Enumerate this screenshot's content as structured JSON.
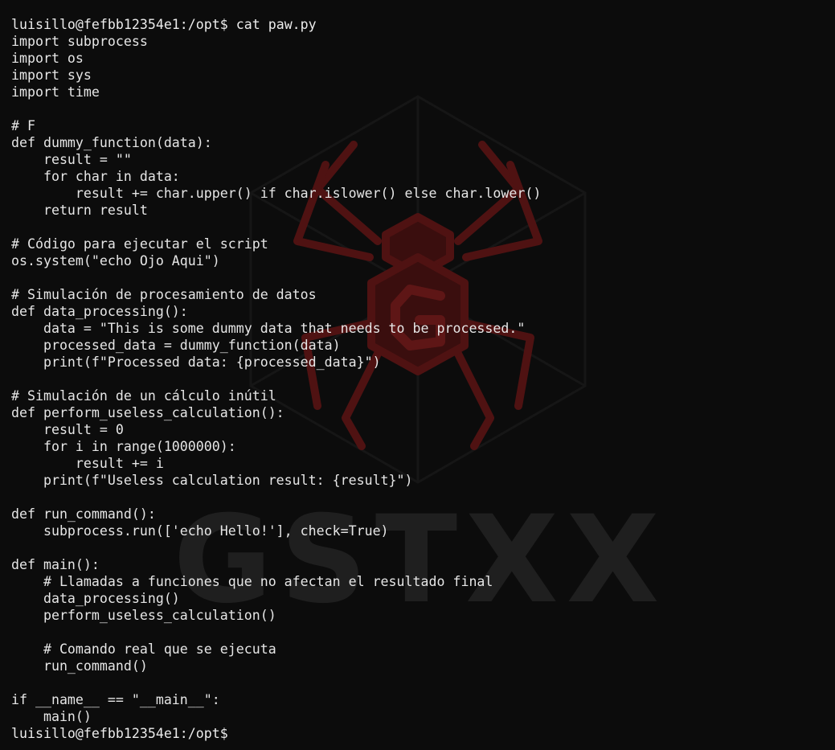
{
  "terminal": {
    "prompt": "luisillo@fefbb12354e1:/opt$",
    "command": "cat paw.py",
    "file_lines": [
      "import subprocess",
      "import os",
      "import sys",
      "import time",
      "",
      "# F",
      "def dummy_function(data):",
      "    result = \"\"",
      "    for char in data:",
      "        result += char.upper() if char.islower() else char.lower()",
      "    return result",
      "",
      "# Código para ejecutar el script",
      "os.system(\"echo Ojo Aqui\")",
      "",
      "# Simulación de procesamiento de datos",
      "def data_processing():",
      "    data = \"This is some dummy data that needs to be processed.\"",
      "    processed_data = dummy_function(data)",
      "    print(f\"Processed data: {processed_data}\")",
      "",
      "# Simulación de un cálculo inútil",
      "def perform_useless_calculation():",
      "    result = 0",
      "    for i in range(1000000):",
      "        result += i",
      "    print(f\"Useless calculation result: {result}\")",
      "",
      "def run_command():",
      "    subprocess.run(['echo Hello!'], check=True)",
      "",
      "def main():",
      "    # Llamadas a funciones que no afectan el resultado final",
      "    data_processing()",
      "    perform_useless_calculation()",
      "",
      "    # Comando real que se ejecuta",
      "    run_command()",
      "",
      "if __name__ == \"__main__\":",
      "    main()"
    ],
    "final_prompt": "luisillo@fefbb12354e1:/opt$"
  },
  "watermark": {
    "text": "GSTXX",
    "spider_color": "#5a1414",
    "text_color": "#262626"
  },
  "colors": {
    "background": "#0c0c0c",
    "foreground": "#e6e6e6"
  }
}
